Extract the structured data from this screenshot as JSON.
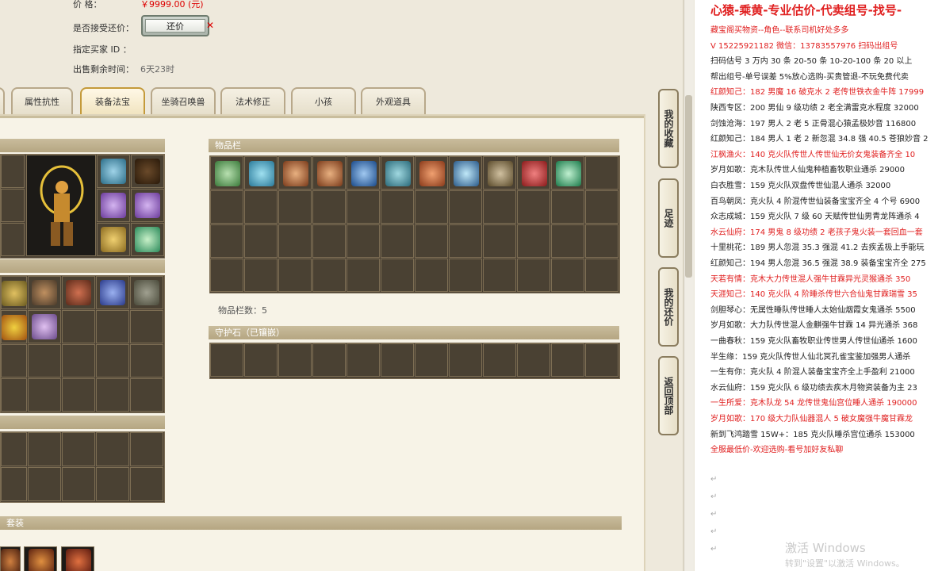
{
  "info": {
    "price_label": "价          格：",
    "price_value": "￥9999.00 (元)",
    "accept_offer_label": "是否接受还价：",
    "offer_button": "还价",
    "buyer_label": "指定买家 ID ：",
    "time_label": "出售剩余时间：",
    "time_value": "6天23时"
  },
  "tabs": [
    "属性抗性",
    "装备法宝",
    "坐骑召唤兽",
    "法术修正",
    "小孩",
    "外观道具"
  ],
  "active_tab": "装备法宝",
  "inventory": {
    "title": "物品栏",
    "count_label": "物品栏数：5"
  },
  "guard_stone": {
    "title": "守护石（已镶嵌）"
  },
  "set_title": "套装",
  "side_buttons": [
    {
      "label": "我的收藏"
    },
    {
      "label": "足迹"
    },
    {
      "label": "我的还价"
    },
    {
      "label": "返回顶部"
    }
  ],
  "right_panel": {
    "header": "心猿-乘黄-专业估价-代卖组号-找号-",
    "lines": [
      {
        "text": "藏宝阁买物资--角色--联系司机好处多多",
        "color": "red"
      },
      {
        "text": "V 15225921182  微信：13783557976  扫码出组号",
        "color": "red"
      },
      {
        "text": "扫码估号 3 万内 30 条  20-50 条  10-20-100 条  20 以上",
        "color": "black"
      },
      {
        "text": "帮出组号-单号误差 5%放心选购-买贵管退-不玩免费代卖",
        "color": "black"
      },
      {
        "text": "红颜知己：182 男魔 16 破克水 2 老传世铁衣金牛阵 17999",
        "color": "red"
      },
      {
        "text": "陕西专区：200 男仙 9 级功绩 2 老全满雷克水程度 32000",
        "color": "black"
      },
      {
        "text": "剑蚀沧海：197 男人 2 老 5 正骨混心猿孟极妙音 116800",
        "color": "black"
      },
      {
        "text": "红颜知己：184 男人 1 老 2 新忽混 34.8 强 40.5 苍狼妙音 2",
        "color": "black"
      },
      {
        "text": "江枫渔火：140 克火队传世人传世仙无价女鬼装备齐全 10",
        "color": "red"
      },
      {
        "text": "岁月如歌：克木队传世人仙鬼种植畜牧职业通杀 29000",
        "color": "black"
      },
      {
        "text": "白衣胜雪：159 克火队双盘传世仙混人通杀 32000",
        "color": "black"
      },
      {
        "text": "百鸟朝凤：克火队 4 阶混传世仙装备宝宝齐全 4 个号 6900",
        "color": "black"
      },
      {
        "text": "众志成城：159 克火队 7 级 60 天赋传世仙男青龙阵通杀 4",
        "color": "black"
      },
      {
        "text": "水云仙府：174 男鬼 8 级功绩 2 老孩子鬼火装一套回血一套",
        "color": "red"
      },
      {
        "text": "十里桃花：189 男人忽混 35.3 强混 41.2 去疾孟极上手能玩",
        "color": "black"
      },
      {
        "text": "红颜知己：194 男人忽混 36.5 强混 38.9 装备宝宝齐全 275",
        "color": "black"
      },
      {
        "text": "天若有情：克木大力传世混人强牛甘霖异光灵猴通杀 350",
        "color": "red"
      },
      {
        "text": "天涯知己：140 克火队 4 阶睡杀传世六合仙鬼甘霖瑞雪 35",
        "color": "red"
      },
      {
        "text": "剑胆琴心：无属性睡队传世睡人太始仙烟霞女鬼通杀 5500",
        "color": "black"
      },
      {
        "text": "岁月如歌：大力队传世混人金麒强牛甘霖 14 异光通杀 368",
        "color": "black"
      },
      {
        "text": "一曲春秋：159 克火队畜牧职业传世男人传世仙通杀 1600",
        "color": "black"
      },
      {
        "text": "半生缘：159 克火队传世人仙北冥孔雀宝鉴加强男人通杀",
        "color": "black"
      },
      {
        "text": "一生有你：克火队 4 阶混人装备宝宝齐全上手盈利 21000",
        "color": "black"
      },
      {
        "text": "水云仙府：159 克火队 6 级功绩去疾木月物资装备为主 23",
        "color": "black"
      },
      {
        "text": "一生所爱：克木队龙 54 龙传世鬼仙宫位睡人通杀 190000",
        "color": "red"
      },
      {
        "text": "岁月如歌：170 级大力队仙器混人 5 破女魔强牛魔甘霖龙",
        "color": "red"
      },
      {
        "text": "新到飞鸿踏雪 15W+：185 克火队睡杀宫位通杀 153000",
        "color": "black"
      },
      {
        "text": "全服最低价-欢迎选购-看号加好友私聊",
        "color": "red"
      }
    ]
  },
  "windows_watermark": {
    "line1": "激活 Windows",
    "line2": "转到\"设置\"以激活 Windows。"
  },
  "colors": {
    "accent_red": "#e02020",
    "panel_dark": "#4a4133",
    "tab_active": "#c49a3a"
  }
}
